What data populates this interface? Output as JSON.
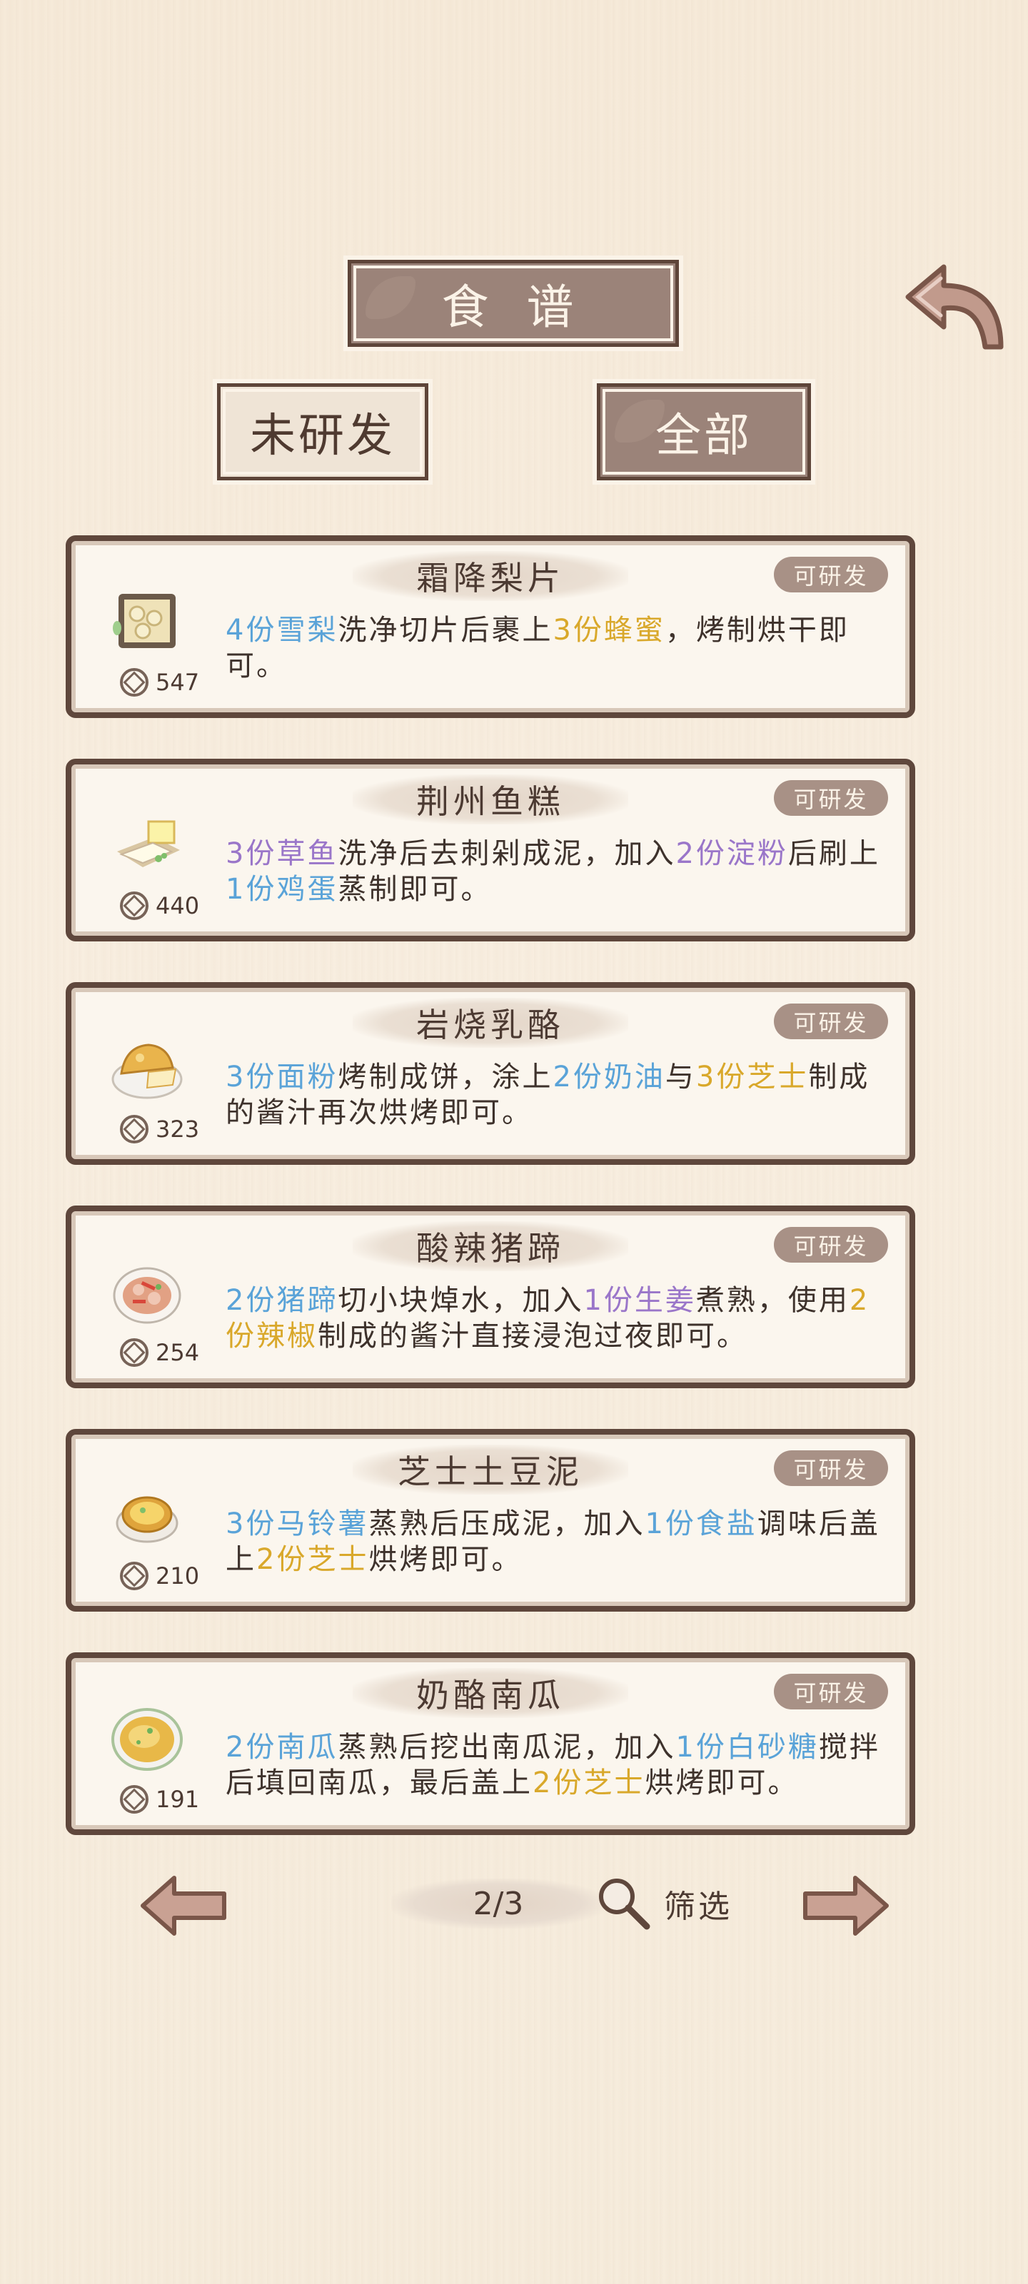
{
  "header": {
    "title": "食 谱"
  },
  "tabs": [
    {
      "label": "未研发"
    },
    {
      "label": "全部"
    }
  ],
  "recipes": [
    {
      "name": "霜降梨片",
      "status": "可研发",
      "price": "547",
      "desc": [
        {
          "t": "4份雪梨",
          "c": "b"
        },
        {
          "t": "洗净切片后裹上",
          "c": ""
        },
        {
          "t": "3份蜂蜜",
          "c": "y"
        },
        {
          "t": "，烤制烘干即可。",
          "c": ""
        }
      ]
    },
    {
      "name": "荆州鱼糕",
      "status": "可研发",
      "price": "440",
      "desc": [
        {
          "t": "3份草鱼",
          "c": "p"
        },
        {
          "t": "洗净后去刺剁成泥，加入",
          "c": ""
        },
        {
          "t": "2份淀粉",
          "c": "p"
        },
        {
          "t": "后刷上",
          "c": ""
        },
        {
          "t": "1份鸡蛋",
          "c": "b"
        },
        {
          "t": "蒸制即可。",
          "c": ""
        }
      ]
    },
    {
      "name": "岩烧乳酪",
      "status": "可研发",
      "price": "323",
      "desc": [
        {
          "t": "3份面粉",
          "c": "b"
        },
        {
          "t": "烤制成饼，涂上",
          "c": ""
        },
        {
          "t": "2份奶油",
          "c": "b"
        },
        {
          "t": "与",
          "c": ""
        },
        {
          "t": "3份芝士",
          "c": "y"
        },
        {
          "t": "制成的酱汁再次烘烤即可。",
          "c": ""
        }
      ]
    },
    {
      "name": "酸辣猪蹄",
      "status": "可研发",
      "price": "254",
      "desc": [
        {
          "t": "2份猪蹄",
          "c": "b"
        },
        {
          "t": "切小块焯水，加入",
          "c": ""
        },
        {
          "t": "1份生姜",
          "c": "p"
        },
        {
          "t": "煮熟，使用",
          "c": ""
        },
        {
          "t": "2份辣椒",
          "c": "y"
        },
        {
          "t": "制成的酱汁直接浸泡过夜即可。",
          "c": ""
        }
      ]
    },
    {
      "name": "芝士土豆泥",
      "status": "可研发",
      "price": "210",
      "desc": [
        {
          "t": "3份马铃薯",
          "c": "b"
        },
        {
          "t": "蒸熟后压成泥，加入",
          "c": ""
        },
        {
          "t": "1份食盐",
          "c": "b"
        },
        {
          "t": "调味后盖上",
          "c": ""
        },
        {
          "t": "2份芝士",
          "c": "y"
        },
        {
          "t": "烘烤即可。",
          "c": ""
        }
      ]
    },
    {
      "name": "奶酪南瓜",
      "status": "可研发",
      "price": "191",
      "desc": [
        {
          "t": "2份南瓜",
          "c": "b"
        },
        {
          "t": "蒸熟后挖出南瓜泥，加入",
          "c": ""
        },
        {
          "t": "1份白砂糖",
          "c": "b"
        },
        {
          "t": "搅拌后填回南瓜，最后盖上",
          "c": ""
        },
        {
          "t": "2份芝士",
          "c": "y"
        },
        {
          "t": "烘烤即可。",
          "c": ""
        }
      ]
    }
  ],
  "pager": {
    "page": "2/3",
    "filter_label": "筛选"
  },
  "icons": {
    "back": "back-arrow-icon",
    "prev": "arrow-left-icon",
    "next": "arrow-right-icon",
    "filter": "magnifier-icon",
    "coin": "coin-icon"
  },
  "colors": {
    "frame": "#5f473c",
    "plaque": "#9b8379",
    "blue": "#5aa3d8",
    "yellow": "#d9a82b",
    "purple": "#9a76c9"
  }
}
